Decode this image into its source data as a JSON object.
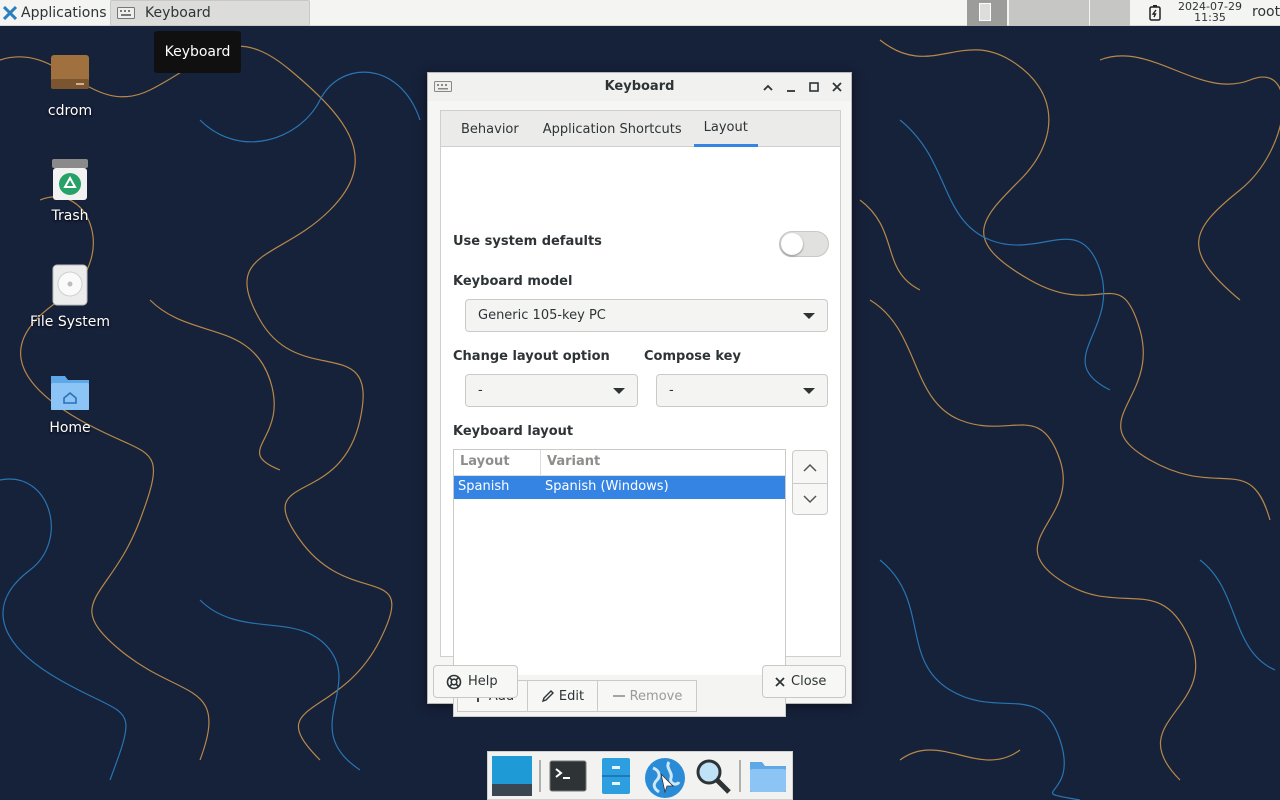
{
  "panel": {
    "applications_label": "Applications",
    "task_label": "Keyboard",
    "clock_date": "2024-07-29",
    "clock_time": "11:35",
    "user": "root"
  },
  "tooltip": "Keyboard",
  "desktop": {
    "icons": [
      {
        "label": "cdrom",
        "icon": "cdrom-drive-icon"
      },
      {
        "label": "Trash",
        "icon": "trash-icon"
      },
      {
        "label": "File System",
        "icon": "hard-drive-icon"
      },
      {
        "label": "Home",
        "icon": "home-folder-icon"
      }
    ]
  },
  "window": {
    "title": "Keyboard",
    "tabs": [
      "Behavior",
      "Application Shortcuts",
      "Layout"
    ],
    "active_tab": "Layout",
    "use_system_defaults_label": "Use system defaults",
    "use_system_defaults_on": false,
    "keyboard_model_label": "Keyboard model",
    "keyboard_model_value": "Generic 105-key PC",
    "change_layout_label": "Change layout option",
    "change_layout_value": "-",
    "compose_key_label": "Compose key",
    "compose_key_value": "-",
    "keyboard_layout_label": "Keyboard layout",
    "columns": [
      "Layout",
      "Variant"
    ],
    "rows": [
      {
        "layout": "Spanish",
        "variant": "Spanish (Windows)",
        "selected": true
      }
    ],
    "add_label": "Add",
    "edit_label": "Edit",
    "remove_label": "Remove",
    "help_label": "Help",
    "close_label": "Close"
  },
  "colors": {
    "accent": "#3584e4",
    "wallpaper_bg": "#16213a",
    "wallpaper_line_orange": "#c9944a",
    "wallpaper_line_blue": "#2a7fc0"
  }
}
